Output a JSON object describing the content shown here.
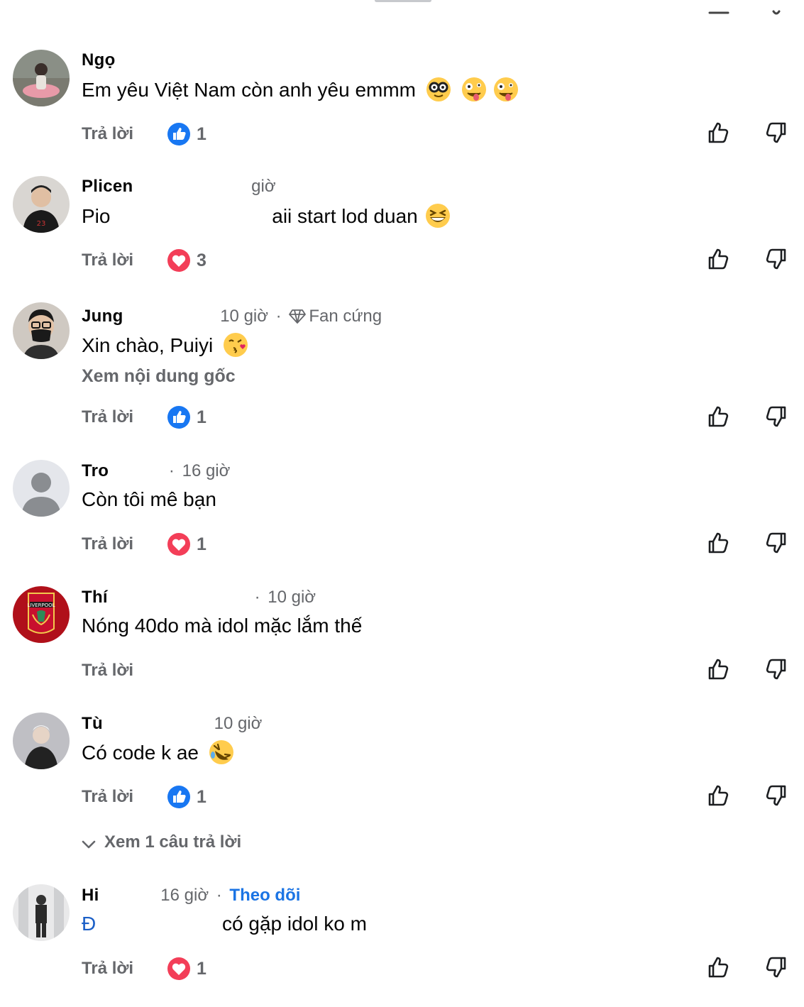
{
  "reply_label": "Trả lời",
  "comments": [
    {
      "author": "Ngọ",
      "time": "",
      "text": "Em yêu Việt Nam còn anh yêu emmm",
      "emojis": [
        "nerd",
        "zany",
        "zany"
      ],
      "reaction": {
        "type": "like",
        "count": "1"
      }
    },
    {
      "author": "Plicen",
      "time": "giờ",
      "text_prefix": "Pio",
      "text": "aii start lod duan",
      "emojis": [
        "grinning-squint"
      ],
      "reaction": {
        "type": "love",
        "count": "3"
      }
    },
    {
      "author": "Jung",
      "time": "10 giờ",
      "badge": "Fan cứng",
      "text": "Xin chào, Puiyi",
      "emojis": [
        "kiss"
      ],
      "see_original": "Xem nội dung gốc",
      "reaction": {
        "type": "like",
        "count": "1"
      }
    },
    {
      "author": "Tro",
      "time": "16 giờ",
      "text": "Còn tôi mê bạn",
      "emojis": [],
      "reaction": {
        "type": "love",
        "count": "1"
      }
    },
    {
      "author": "Thí",
      "time": "10 giờ",
      "text": "Nóng 40do mà idol mặc lắm thế",
      "emojis": [],
      "reaction": null
    },
    {
      "author": "Tù",
      "time": "10 giờ",
      "text": "Có code k ae",
      "emojis": [
        "rofl"
      ],
      "reaction": {
        "type": "like",
        "count": "1"
      },
      "view_replies": "Xem 1 câu trả lời"
    },
    {
      "author": "Hi",
      "time": "16 giờ",
      "follow": "Theo dõi",
      "mention": "Đ",
      "text": "có gặp idol ko m",
      "emojis": [],
      "reaction": {
        "type": "love",
        "count": "1"
      }
    }
  ],
  "colors": {
    "like_blue": "#1877f2",
    "love_red": "#f33e58",
    "follow_blue": "#1b74e4",
    "secondary_text": "#65676b"
  },
  "icons": {
    "upvote": "thumb-up-outline-icon",
    "downvote": "thumb-down-outline-icon",
    "fan_badge": "diamond-icon",
    "expand": "chevron-down-icon"
  }
}
